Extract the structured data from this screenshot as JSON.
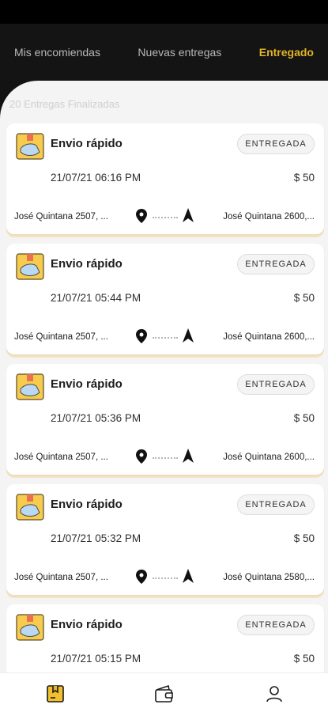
{
  "tabs": [
    {
      "label": "Mis encomiendas",
      "active": false
    },
    {
      "label": "Nuevas entregas",
      "active": false
    },
    {
      "label": "Entregado",
      "active": true
    }
  ],
  "summary": "20 Entregas Finalizadas",
  "deliveries": [
    {
      "title": "Envio rápido",
      "status": "ENTREGADA",
      "datetime": "21/07/21 06:16 PM",
      "price": "$ 50",
      "origin": "José Quintana 2507, ...",
      "destination": "José Quintana 2600,..."
    },
    {
      "title": "Envio rápido",
      "status": "ENTREGADA",
      "datetime": "21/07/21 05:44 PM",
      "price": "$ 50",
      "origin": "José Quintana 2507, ...",
      "destination": "José Quintana 2600,..."
    },
    {
      "title": "Envio rápido",
      "status": "ENTREGADA",
      "datetime": "21/07/21 05:36 PM",
      "price": "$ 50",
      "origin": "José Quintana 2507, ...",
      "destination": "José Quintana 2600,..."
    },
    {
      "title": "Envio rápido",
      "status": "ENTREGADA",
      "datetime": "21/07/21 05:32 PM",
      "price": "$ 50",
      "origin": "José Quintana 2507, ...",
      "destination": "José Quintana 2580,..."
    },
    {
      "title": "Envio rápido",
      "status": "ENTREGADA",
      "datetime": "21/07/21 05:15 PM",
      "price": "$ 50",
      "origin": "",
      "destination": ""
    }
  ],
  "bottom_nav": [
    {
      "icon": "package-icon",
      "active": true
    },
    {
      "icon": "wallet-icon",
      "active": false
    },
    {
      "icon": "user-icon",
      "active": false
    }
  ],
  "colors": {
    "accent": "#e2b424",
    "header_bg": "#141414",
    "content_bg": "#f4f4f4",
    "card_underlay": "#f3e4c2"
  }
}
